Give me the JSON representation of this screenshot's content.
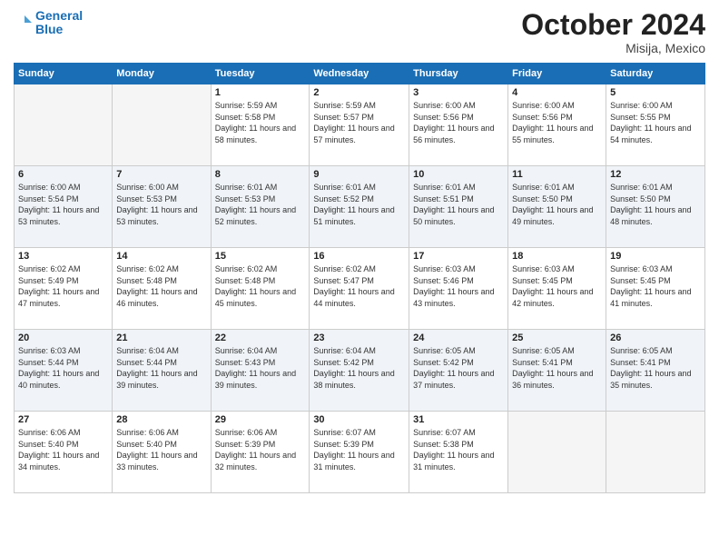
{
  "header": {
    "logo_line1": "General",
    "logo_line2": "Blue",
    "month": "October 2024",
    "location": "Misija, Mexico"
  },
  "weekdays": [
    "Sunday",
    "Monday",
    "Tuesday",
    "Wednesday",
    "Thursday",
    "Friday",
    "Saturday"
  ],
  "weeks": [
    [
      {
        "day": "",
        "sunrise": "",
        "sunset": "",
        "daylight": "",
        "empty": true
      },
      {
        "day": "",
        "sunrise": "",
        "sunset": "",
        "daylight": "",
        "empty": true
      },
      {
        "day": "1",
        "sunrise": "Sunrise: 5:59 AM",
        "sunset": "Sunset: 5:58 PM",
        "daylight": "Daylight: 11 hours and 58 minutes."
      },
      {
        "day": "2",
        "sunrise": "Sunrise: 5:59 AM",
        "sunset": "Sunset: 5:57 PM",
        "daylight": "Daylight: 11 hours and 57 minutes."
      },
      {
        "day": "3",
        "sunrise": "Sunrise: 6:00 AM",
        "sunset": "Sunset: 5:56 PM",
        "daylight": "Daylight: 11 hours and 56 minutes."
      },
      {
        "day": "4",
        "sunrise": "Sunrise: 6:00 AM",
        "sunset": "Sunset: 5:56 PM",
        "daylight": "Daylight: 11 hours and 55 minutes."
      },
      {
        "day": "5",
        "sunrise": "Sunrise: 6:00 AM",
        "sunset": "Sunset: 5:55 PM",
        "daylight": "Daylight: 11 hours and 54 minutes."
      }
    ],
    [
      {
        "day": "6",
        "sunrise": "Sunrise: 6:00 AM",
        "sunset": "Sunset: 5:54 PM",
        "daylight": "Daylight: 11 hours and 53 minutes."
      },
      {
        "day": "7",
        "sunrise": "Sunrise: 6:00 AM",
        "sunset": "Sunset: 5:53 PM",
        "daylight": "Daylight: 11 hours and 53 minutes."
      },
      {
        "day": "8",
        "sunrise": "Sunrise: 6:01 AM",
        "sunset": "Sunset: 5:53 PM",
        "daylight": "Daylight: 11 hours and 52 minutes."
      },
      {
        "day": "9",
        "sunrise": "Sunrise: 6:01 AM",
        "sunset": "Sunset: 5:52 PM",
        "daylight": "Daylight: 11 hours and 51 minutes."
      },
      {
        "day": "10",
        "sunrise": "Sunrise: 6:01 AM",
        "sunset": "Sunset: 5:51 PM",
        "daylight": "Daylight: 11 hours and 50 minutes."
      },
      {
        "day": "11",
        "sunrise": "Sunrise: 6:01 AM",
        "sunset": "Sunset: 5:50 PM",
        "daylight": "Daylight: 11 hours and 49 minutes."
      },
      {
        "day": "12",
        "sunrise": "Sunrise: 6:01 AM",
        "sunset": "Sunset: 5:50 PM",
        "daylight": "Daylight: 11 hours and 48 minutes."
      }
    ],
    [
      {
        "day": "13",
        "sunrise": "Sunrise: 6:02 AM",
        "sunset": "Sunset: 5:49 PM",
        "daylight": "Daylight: 11 hours and 47 minutes."
      },
      {
        "day": "14",
        "sunrise": "Sunrise: 6:02 AM",
        "sunset": "Sunset: 5:48 PM",
        "daylight": "Daylight: 11 hours and 46 minutes."
      },
      {
        "day": "15",
        "sunrise": "Sunrise: 6:02 AM",
        "sunset": "Sunset: 5:48 PM",
        "daylight": "Daylight: 11 hours and 45 minutes."
      },
      {
        "day": "16",
        "sunrise": "Sunrise: 6:02 AM",
        "sunset": "Sunset: 5:47 PM",
        "daylight": "Daylight: 11 hours and 44 minutes."
      },
      {
        "day": "17",
        "sunrise": "Sunrise: 6:03 AM",
        "sunset": "Sunset: 5:46 PM",
        "daylight": "Daylight: 11 hours and 43 minutes."
      },
      {
        "day": "18",
        "sunrise": "Sunrise: 6:03 AM",
        "sunset": "Sunset: 5:45 PM",
        "daylight": "Daylight: 11 hours and 42 minutes."
      },
      {
        "day": "19",
        "sunrise": "Sunrise: 6:03 AM",
        "sunset": "Sunset: 5:45 PM",
        "daylight": "Daylight: 11 hours and 41 minutes."
      }
    ],
    [
      {
        "day": "20",
        "sunrise": "Sunrise: 6:03 AM",
        "sunset": "Sunset: 5:44 PM",
        "daylight": "Daylight: 11 hours and 40 minutes."
      },
      {
        "day": "21",
        "sunrise": "Sunrise: 6:04 AM",
        "sunset": "Sunset: 5:44 PM",
        "daylight": "Daylight: 11 hours and 39 minutes."
      },
      {
        "day": "22",
        "sunrise": "Sunrise: 6:04 AM",
        "sunset": "Sunset: 5:43 PM",
        "daylight": "Daylight: 11 hours and 39 minutes."
      },
      {
        "day": "23",
        "sunrise": "Sunrise: 6:04 AM",
        "sunset": "Sunset: 5:42 PM",
        "daylight": "Daylight: 11 hours and 38 minutes."
      },
      {
        "day": "24",
        "sunrise": "Sunrise: 6:05 AM",
        "sunset": "Sunset: 5:42 PM",
        "daylight": "Daylight: 11 hours and 37 minutes."
      },
      {
        "day": "25",
        "sunrise": "Sunrise: 6:05 AM",
        "sunset": "Sunset: 5:41 PM",
        "daylight": "Daylight: 11 hours and 36 minutes."
      },
      {
        "day": "26",
        "sunrise": "Sunrise: 6:05 AM",
        "sunset": "Sunset: 5:41 PM",
        "daylight": "Daylight: 11 hours and 35 minutes."
      }
    ],
    [
      {
        "day": "27",
        "sunrise": "Sunrise: 6:06 AM",
        "sunset": "Sunset: 5:40 PM",
        "daylight": "Daylight: 11 hours and 34 minutes."
      },
      {
        "day": "28",
        "sunrise": "Sunrise: 6:06 AM",
        "sunset": "Sunset: 5:40 PM",
        "daylight": "Daylight: 11 hours and 33 minutes."
      },
      {
        "day": "29",
        "sunrise": "Sunrise: 6:06 AM",
        "sunset": "Sunset: 5:39 PM",
        "daylight": "Daylight: 11 hours and 32 minutes."
      },
      {
        "day": "30",
        "sunrise": "Sunrise: 6:07 AM",
        "sunset": "Sunset: 5:39 PM",
        "daylight": "Daylight: 11 hours and 31 minutes."
      },
      {
        "day": "31",
        "sunrise": "Sunrise: 6:07 AM",
        "sunset": "Sunset: 5:38 PM",
        "daylight": "Daylight: 11 hours and 31 minutes."
      },
      {
        "day": "",
        "sunrise": "",
        "sunset": "",
        "daylight": "",
        "empty": true
      },
      {
        "day": "",
        "sunrise": "",
        "sunset": "",
        "daylight": "",
        "empty": true
      }
    ]
  ]
}
